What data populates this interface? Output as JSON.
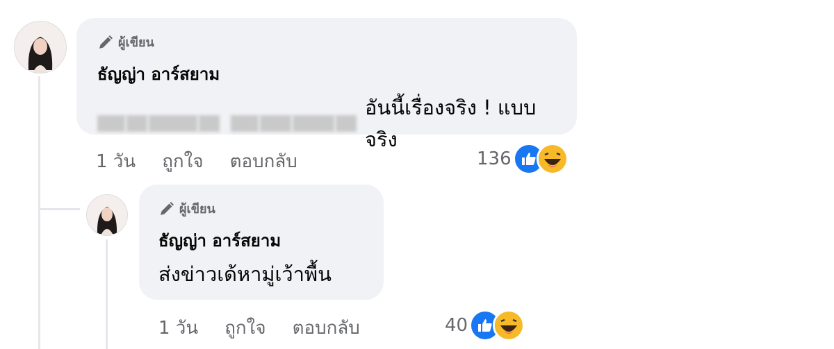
{
  "comments": [
    {
      "author_badge": "ผู้เขียน",
      "author_name": "ธัญญ่า อาร์สยาม",
      "text": "อันนี้เรื่องจริง ! แบบจริง",
      "time": "1 วัน",
      "like_label": "ถูกใจ",
      "reply_label": "ตอบกลับ",
      "reaction_count": "136",
      "reactions": [
        "like-icon",
        "haha-icon"
      ]
    }
  ],
  "replies": [
    {
      "author_badge": "ผู้เขียน",
      "author_name": "ธัญญ่า อาร์สยาม",
      "text": "ส่งข่าวเด้หามู่เว้าพื้น",
      "time": "1 วัน",
      "like_label": "ถูกใจ",
      "reply_label": "ตอบกลับ",
      "reaction_count": "40",
      "reactions": [
        "like-icon",
        "haha-icon"
      ]
    }
  ],
  "colors": {
    "bubble": "#f0f2f5",
    "secondary_text": "#65676b",
    "like_blue": "#1877f2",
    "haha_yellow": "#f7b928"
  }
}
